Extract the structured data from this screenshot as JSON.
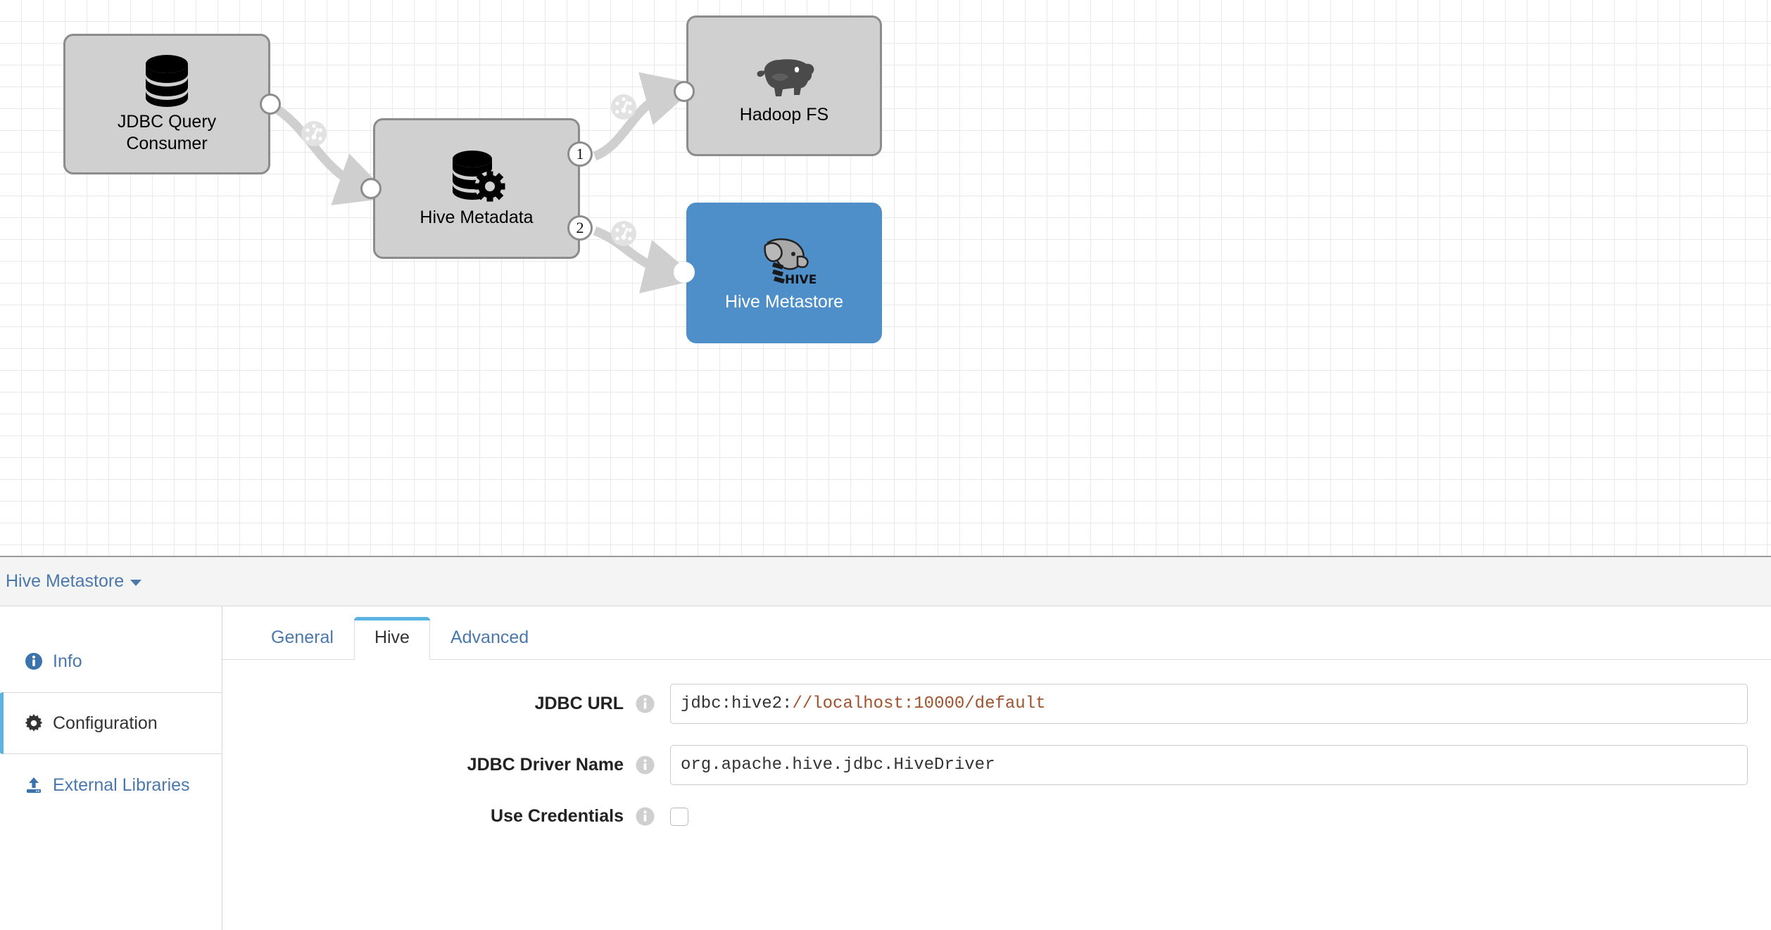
{
  "canvas": {
    "nodes": [
      {
        "id": "jdbc-query-consumer",
        "label": "JDBC Query\nConsumer",
        "icon": "database-icon",
        "selected": false
      },
      {
        "id": "hive-metadata",
        "label": "Hive Metadata",
        "icon": "database-gear-icon",
        "selected": false
      },
      {
        "id": "hadoop-fs",
        "label": "Hadoop FS",
        "icon": "hadoop-elephant-icon",
        "selected": false
      },
      {
        "id": "hive-metastore",
        "label": "Hive Metastore",
        "icon": "hive-elephant-icon",
        "selected": true
      }
    ],
    "output_badges": [
      "1",
      "2"
    ],
    "link_icon": "gauge-icon",
    "colors": {
      "node_fill": "#d0d0d0",
      "node_border": "#8c8c8c",
      "selected_fill": "#4f8fc9",
      "link": "#cfcfcf",
      "grid": "#e9e9e9"
    }
  },
  "panel": {
    "stage_selector_label": "Hive Metastore",
    "stage_selector_icon": "chevron-down-icon",
    "side_nav": [
      {
        "label": "Info",
        "icon": "info-circle-icon",
        "active": false
      },
      {
        "label": "Configuration",
        "icon": "gear-icon",
        "active": true
      },
      {
        "label": "External Libraries",
        "icon": "upload-icon",
        "active": false
      }
    ],
    "tabs": [
      {
        "label": "General",
        "active": false
      },
      {
        "label": "Hive",
        "active": true
      },
      {
        "label": "Advanced",
        "active": false
      }
    ],
    "fields": [
      {
        "label": "JDBC URL",
        "info_icon": "info-icon",
        "type": "text",
        "value_prefix": "jdbc:hive2:",
        "value_suffix": "//localhost:10000/default",
        "value": "jdbc:hive2://localhost:10000/default"
      },
      {
        "label": "JDBC Driver Name",
        "info_icon": "info-icon",
        "type": "text",
        "value_prefix": "org.apache.hive.jdbc.HiveDriver",
        "value_suffix": "",
        "value": "org.apache.hive.jdbc.HiveDriver"
      },
      {
        "label": "Use Credentials",
        "info_icon": "info-icon",
        "type": "checkbox",
        "checked": false
      }
    ],
    "colors": {
      "link_blue": "#4a78ad",
      "accent_blue": "#5bb3e4",
      "url_token": "#a0522d"
    }
  }
}
